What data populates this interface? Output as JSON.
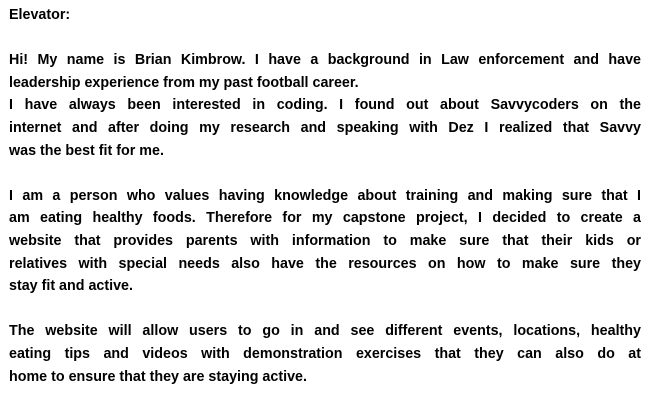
{
  "document": {
    "heading": "Elevator:",
    "paragraphs": [
      {
        "lines": [
          "Hi! My name is Brian Kimbrow. I have a background in Law enforcement and have",
          "leadership experience from my past football career.",
          "I have always been interested in coding. I found out about Savvycoders on the",
          "internet and after doing my research and speaking with Dez I realized that Savvy",
          "was the best fit for me."
        ]
      },
      {
        "lines": [
          "I am a person who values having knowledge about training and making sure that I",
          "am eating healthy foods. Therefore for my capstone project, I decided to create a",
          "website that provides parents with information to make sure that their kids or",
          "relatives with special needs also have the resources on how to make sure they",
          "stay fit and active."
        ]
      },
      {
        "lines": [
          "The website will allow users to go in and see different events, locations, healthy",
          "eating tips and videos with demonstration exercises that they can also do at",
          "home to ensure that they are staying active."
        ]
      }
    ]
  }
}
